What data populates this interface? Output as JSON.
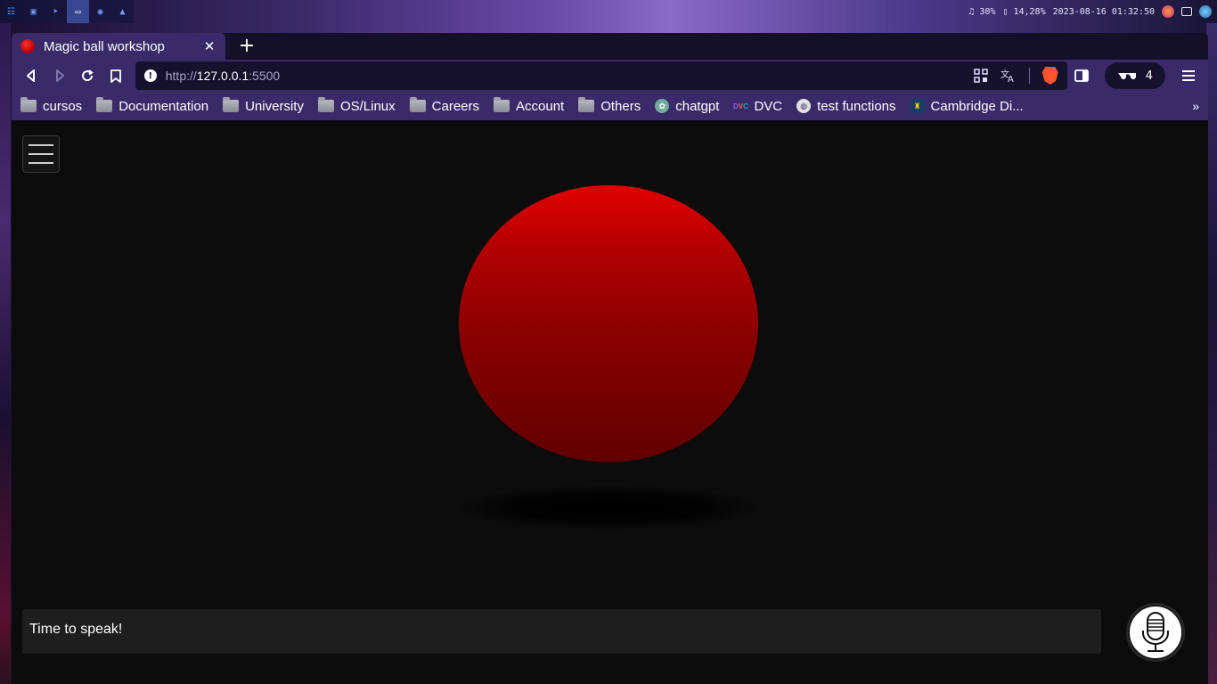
{
  "topbar": {
    "workspaces": [
      "☷",
      "▣",
      "➤",
      "▭",
      "◉",
      "▲"
    ],
    "active_workspace": 3,
    "volume": "♫ 30%",
    "battery": "▯ 14,28%",
    "datetime": "2023-08-16 01:32:50"
  },
  "browser": {
    "tab_title": "Magic ball workshop",
    "tab_close": "✕",
    "new_tab": "+",
    "url_scheme": "http://",
    "url_host": "127.0.0.1",
    "url_port": ":5500",
    "shield_count": "4",
    "bookmarks": [
      {
        "label": "cursos",
        "icon": "folder"
      },
      {
        "label": "Documentation",
        "icon": "folder"
      },
      {
        "label": "University",
        "icon": "folder"
      },
      {
        "label": "OS/Linux",
        "icon": "folder"
      },
      {
        "label": "Careers",
        "icon": "folder"
      },
      {
        "label": "Account",
        "icon": "folder"
      },
      {
        "label": "Others",
        "icon": "folder"
      },
      {
        "label": "chatgpt",
        "icon": "chatgpt"
      },
      {
        "label": "DVC",
        "icon": "dvc"
      },
      {
        "label": "test functions",
        "icon": "globe"
      },
      {
        "label": "Cambridge Di...",
        "icon": "cambridge"
      }
    ],
    "bookmarks_more": "»"
  },
  "page": {
    "speech_text": "Time to speak!",
    "ball_color": "#b00000"
  }
}
